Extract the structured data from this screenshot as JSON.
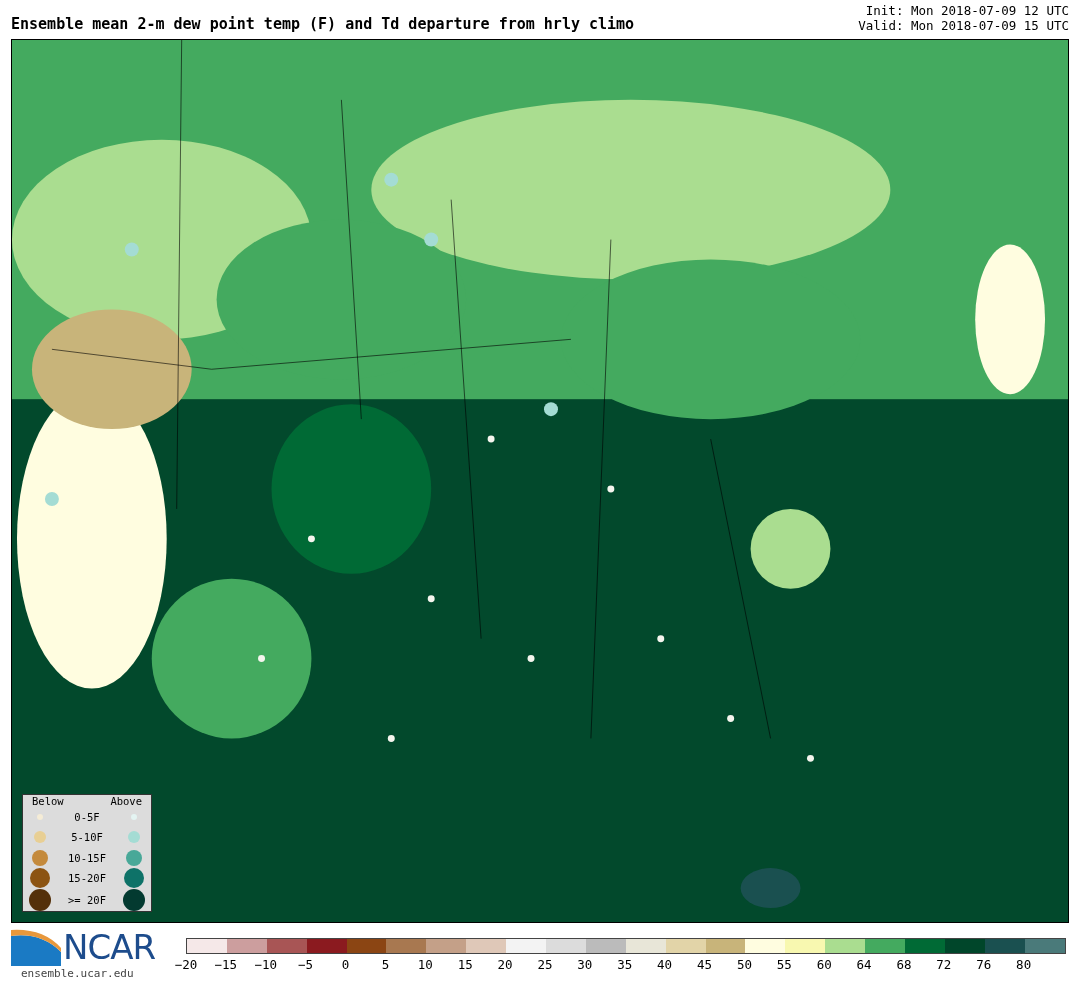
{
  "title": "Ensemble mean 2-m dew point temp (F) and Td departure from hrly climo",
  "init": "Init: Mon 2018-07-09 12 UTC",
  "valid": "Valid: Mon 2018-07-09 15 UTC",
  "legend": {
    "below_heading": "Below",
    "above_heading": "Above",
    "rows": [
      {
        "label": "0-5F",
        "below": {
          "color": "#f5ecd6"
        },
        "above": {
          "color": "#e4f4f2"
        }
      },
      {
        "label": "5-10F",
        "below": {
          "color": "#e8cf94"
        },
        "above": {
          "color": "#a4dcd4"
        }
      },
      {
        "label": "10-15F",
        "below": {
          "color": "#c48a3c"
        },
        "above": {
          "color": "#48a898"
        }
      },
      {
        "label": "15-20F",
        "below": {
          "color": "#8c5412"
        },
        "above": {
          "color": "#0e7268"
        }
      },
      {
        "label": ">= 20F",
        "below": {
          "color": "#54300a"
        },
        "above": {
          "color": "#033a30"
        }
      }
    ]
  },
  "logo": {
    "text": "NCAR",
    "url": "ensemble.ucar.edu"
  },
  "colorbar": {
    "segments": [
      {
        "color": "#f5e8e8"
      },
      {
        "color": "#cc9e9e"
      },
      {
        "color": "#a85555"
      },
      {
        "color": "#8b1a1f"
      },
      {
        "color": "#8b4513"
      },
      {
        "color": "#a87850"
      },
      {
        "color": "#c4a088"
      },
      {
        "color": "#dfc8b8"
      },
      {
        "color": "#f3f3f3"
      },
      {
        "color": "#dcdcdc"
      },
      {
        "color": "#bbbbbb"
      },
      {
        "color": "#e8e6d8"
      },
      {
        "color": "#e2d4a8"
      },
      {
        "color": "#c8b47a"
      },
      {
        "color": "#fffde0"
      },
      {
        "color": "#f8f8b0"
      },
      {
        "color": "#aadd90"
      },
      {
        "color": "#44aa5f"
      },
      {
        "color": "#006a35"
      },
      {
        "color": "#00462a"
      },
      {
        "color": "#1a5050"
      },
      {
        "color": "#4a7a7a"
      }
    ],
    "ticks": [
      "−20",
      "−15",
      "−10",
      "−5",
      "0",
      "5",
      "10",
      "15",
      "20",
      "25",
      "30",
      "35",
      "40",
      "45",
      "50",
      "55",
      "60",
      "64",
      "68",
      "72",
      "76",
      "80"
    ]
  }
}
